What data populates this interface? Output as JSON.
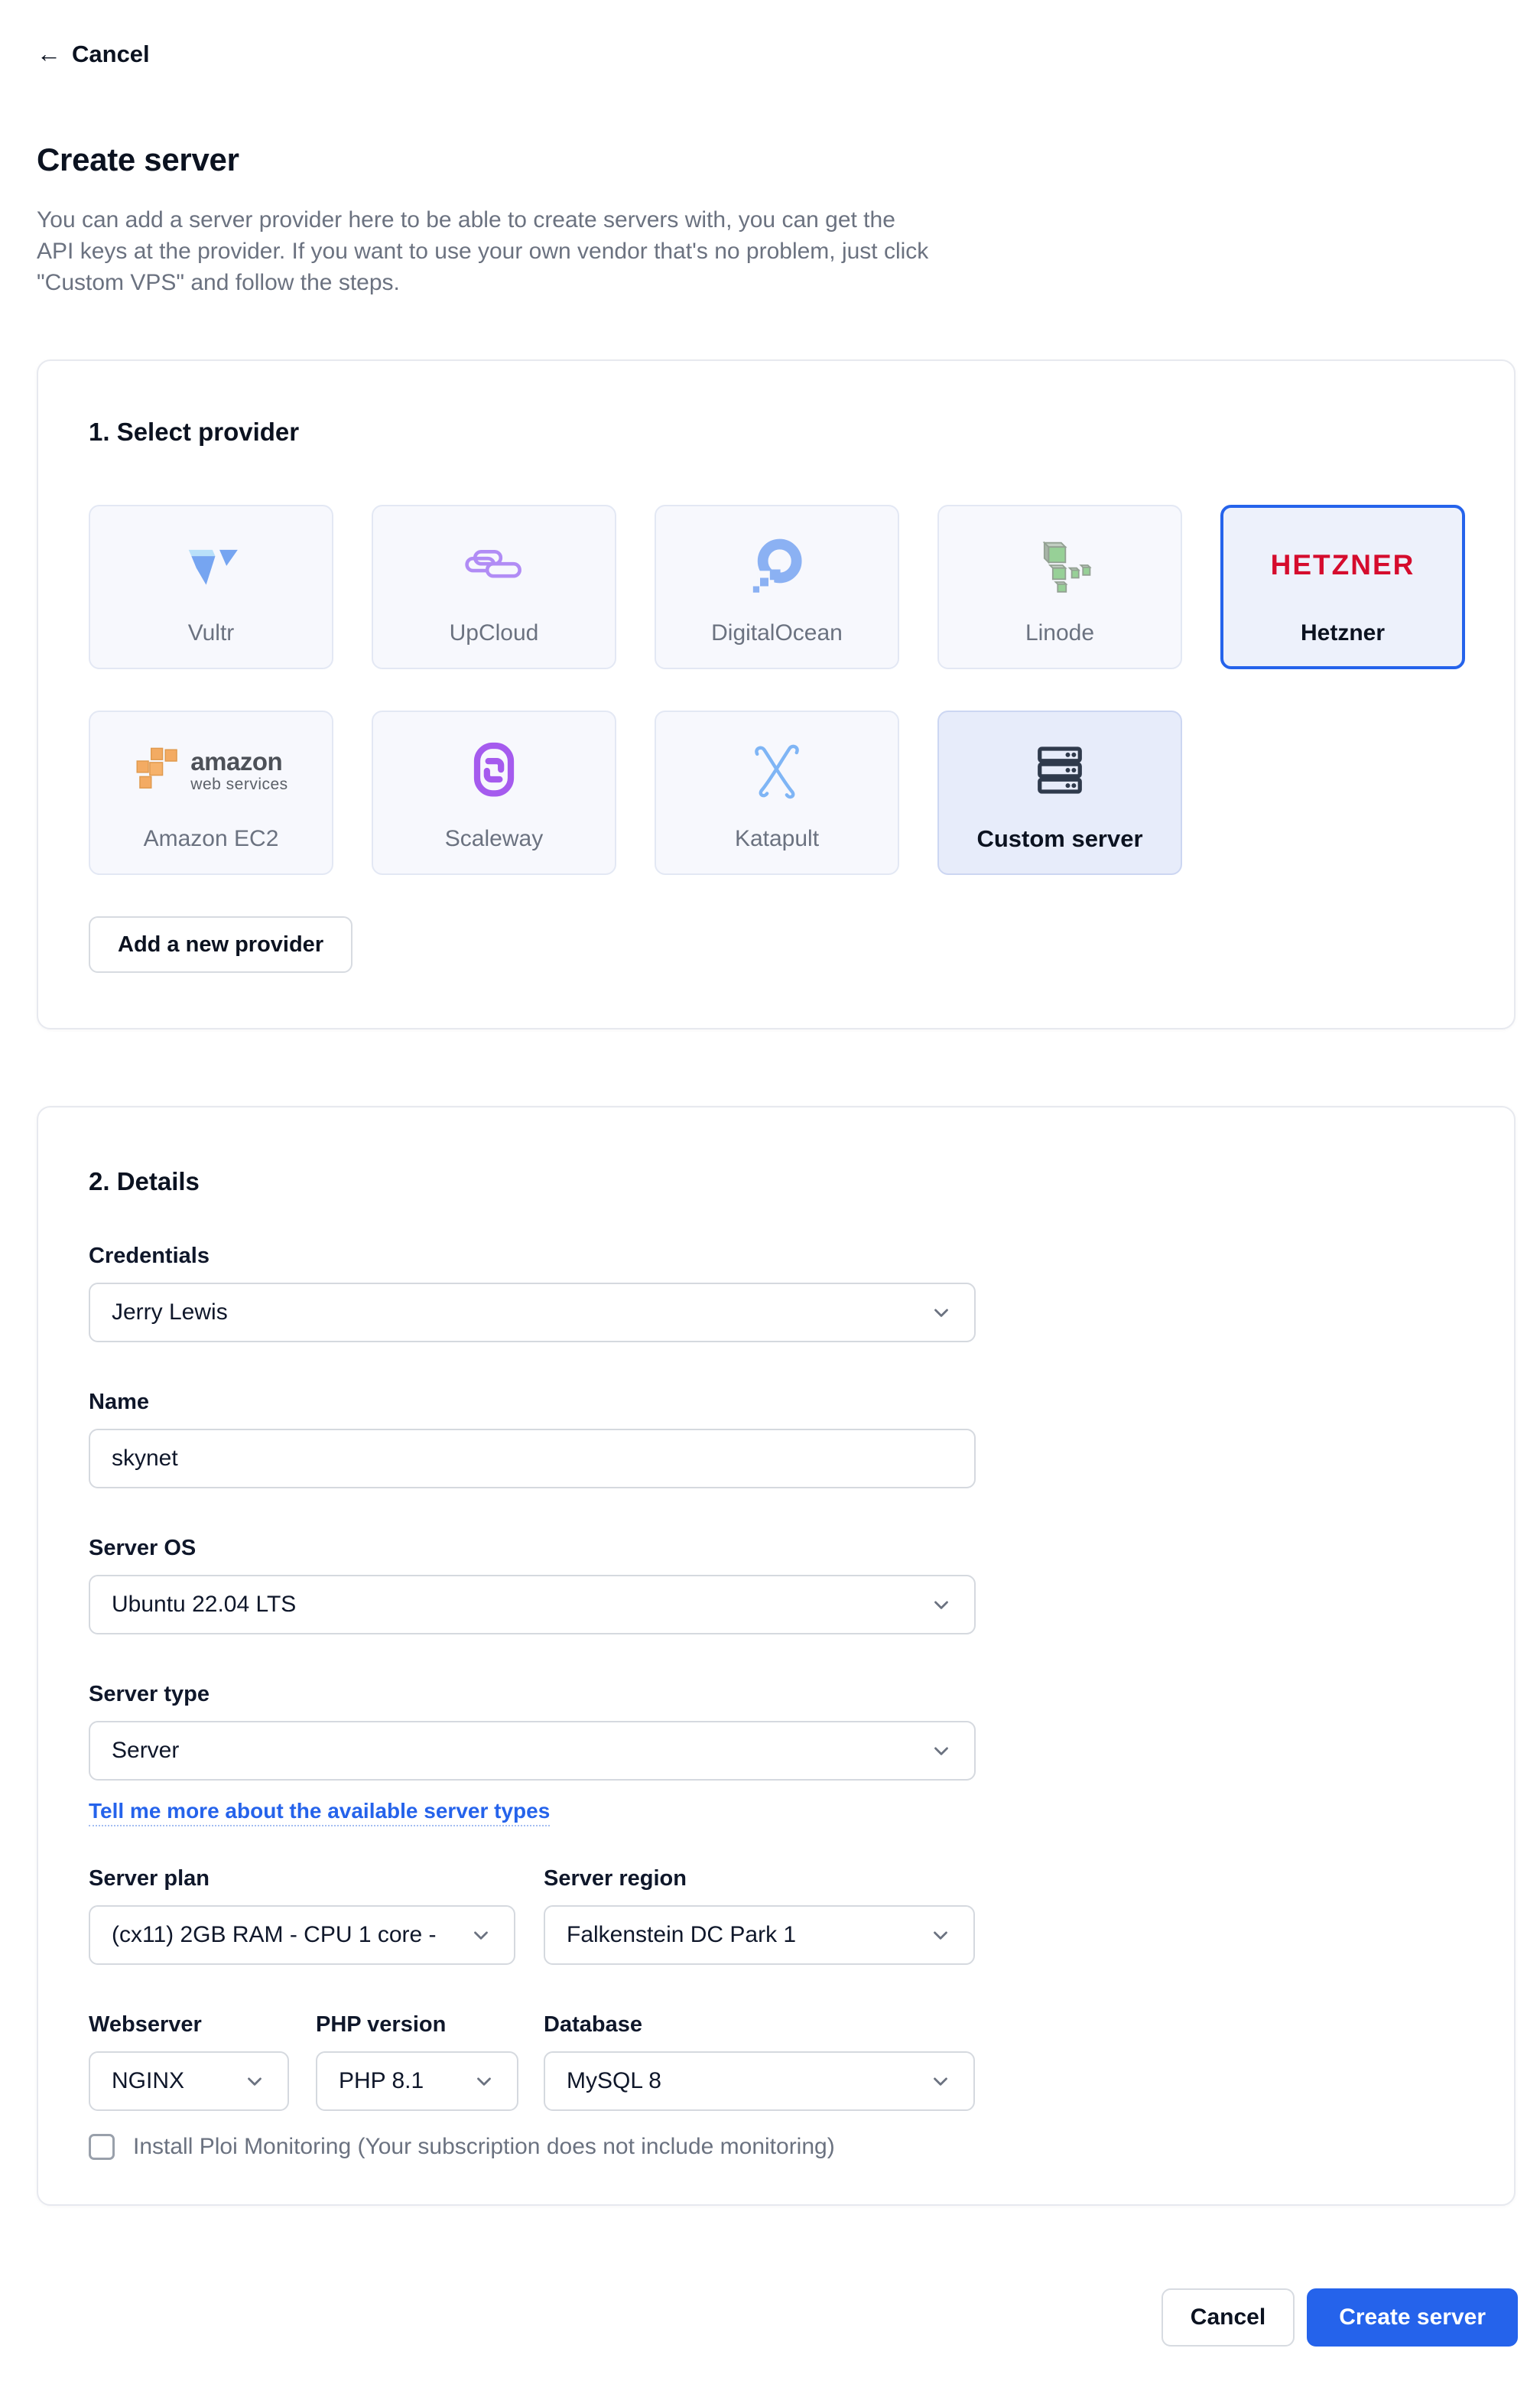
{
  "header": {
    "back_arrow": "←",
    "back_label": "Cancel"
  },
  "page": {
    "title": "Create server",
    "description": "You can add a server provider here to be able to create servers with, you can get the API keys at the provider. If you want to use your own vendor that's no problem, just click \"Custom VPS\" and follow the steps."
  },
  "provider_section": {
    "title": "1. Select provider",
    "providers": [
      {
        "id": "vultr",
        "label": "Vultr",
        "icon": "vultr-logo-icon",
        "selected": false,
        "custom": false
      },
      {
        "id": "upcloud",
        "label": "UpCloud",
        "icon": "upcloud-logo-icon",
        "selected": false,
        "custom": false
      },
      {
        "id": "digitalocean",
        "label": "DigitalOcean",
        "icon": "digitalocean-logo-icon",
        "selected": false,
        "custom": false
      },
      {
        "id": "linode",
        "label": "Linode",
        "icon": "linode-logo-icon",
        "selected": false,
        "custom": false
      },
      {
        "id": "hetzner",
        "label": "Hetzner",
        "icon": "hetzner-logo-icon",
        "selected": true,
        "custom": false,
        "logo_text": "HETZNER"
      },
      {
        "id": "amazon-ec2",
        "label": "Amazon EC2",
        "icon": "aws-logo-icon",
        "selected": false,
        "custom": false,
        "logo_text": "amazon",
        "logo_subtext": "web services"
      },
      {
        "id": "scaleway",
        "label": "Scaleway",
        "icon": "scaleway-logo-icon",
        "selected": false,
        "custom": false
      },
      {
        "id": "katapult",
        "label": "Katapult",
        "icon": "katapult-logo-icon",
        "selected": false,
        "custom": false
      },
      {
        "id": "custom-server",
        "label": "Custom server",
        "icon": "server-stack-icon",
        "selected": false,
        "custom": true
      }
    ],
    "add_button_label": "Add a new provider"
  },
  "details_section": {
    "title": "2. Details",
    "credentials": {
      "label": "Credentials",
      "value": "Jerry Lewis"
    },
    "name": {
      "label": "Name",
      "value": "skynet"
    },
    "server_os": {
      "label": "Server OS",
      "value": "Ubuntu 22.04 LTS"
    },
    "server_type": {
      "label": "Server type",
      "value": "Server"
    },
    "server_type_link": "Tell me more about the available server types",
    "server_plan": {
      "label": "Server plan",
      "value": "(cx11) 2GB RAM - CPU 1 core -"
    },
    "server_region": {
      "label": "Server region",
      "value": "Falkenstein DC Park 1"
    },
    "webserver": {
      "label": "Webserver",
      "value": "NGINX"
    },
    "php_version": {
      "label": "PHP version",
      "value": "PHP 8.1"
    },
    "database": {
      "label": "Database",
      "value": "MySQL 8"
    },
    "monitoring": {
      "label": "Install Ploi Monitoring (Your subscription does not include monitoring)",
      "checked": false
    }
  },
  "footer": {
    "cancel_label": "Cancel",
    "submit_label": "Create server"
  },
  "colors": {
    "accent": "#2563eb",
    "hetzner_red": "#d50c2d",
    "tile_bg": "#f7f8fd",
    "custom_tile_bg": "#e7ecfa",
    "muted_text": "#6b7280"
  }
}
